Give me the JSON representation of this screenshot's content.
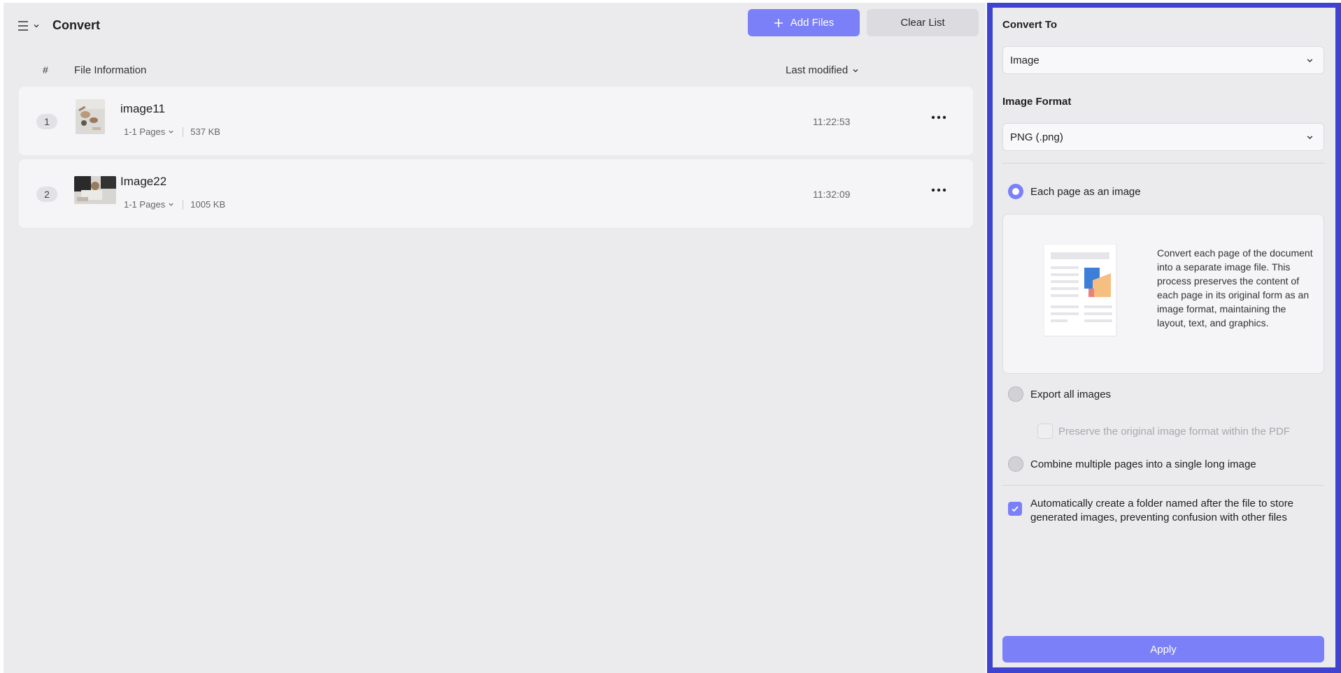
{
  "header": {
    "title": "Convert",
    "add_files_label": "Add Files",
    "clear_list_label": "Clear List"
  },
  "table": {
    "col_index": "#",
    "col_info": "File Information",
    "col_modified": "Last modified"
  },
  "files": [
    {
      "index": "1",
      "name": "image11",
      "pages": "1-1 Pages",
      "size": "537 KB",
      "time": "11:22:53"
    },
    {
      "index": "2",
      "name": "Image22",
      "pages": "1-1 Pages",
      "size": "1005 KB",
      "time": "11:32:09"
    }
  ],
  "panel": {
    "convert_to_label": "Convert To",
    "convert_to_value": "Image",
    "image_format_label": "Image Format",
    "image_format_value": "PNG (.png)",
    "options": {
      "each_page": "Each page as an image",
      "export_all": "Export all images",
      "preserve": "Preserve the original image format within the PDF",
      "combine": "Combine multiple pages into a single long image"
    },
    "selected_option": "each_page",
    "description": "Convert each page of the document into a separate image file. This process preserves the content of each page in its original form as an image format, maintaining the layout, text, and graphics.",
    "auto_folder_text": "Automatically create a folder named after the file to store generated images, preventing confusion with other files",
    "auto_folder_checked": true,
    "apply_label": "Apply"
  },
  "colors": {
    "accent": "#7b80f8",
    "panel_border": "#3f43cf",
    "background": "#ebebee"
  }
}
